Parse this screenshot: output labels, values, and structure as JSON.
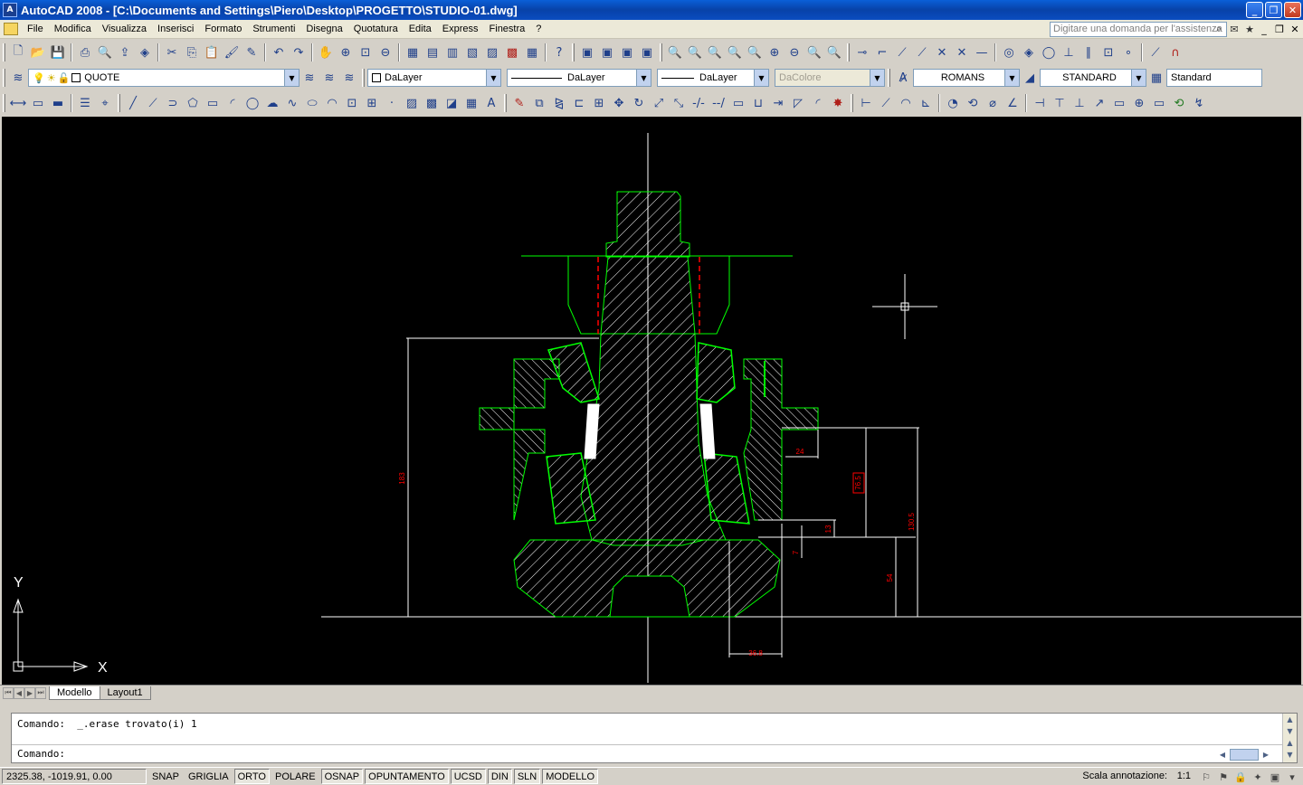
{
  "window": {
    "app_icon_text": "A",
    "title": "AutoCAD 2008 - [C:\\Documents and Settings\\Piero\\Desktop\\PROGETTO\\STUDIO-01.dwg]",
    "buttons": {
      "minimize": "_",
      "maximize": "❐",
      "close": "✕"
    }
  },
  "menu": {
    "items": [
      "File",
      "Modifica",
      "Visualizza",
      "Inserisci",
      "Formato",
      "Strumenti",
      "Disegna",
      "Quotatura",
      "Edita",
      "Express",
      "Finestra",
      "?"
    ],
    "help_placeholder": "Digitare una domanda per l'assistenza",
    "doc_buttons": {
      "minimize": "_",
      "restore": "❐",
      "close": "✕"
    }
  },
  "layers": {
    "current_layer": "QUOTE",
    "color": "DaLayer",
    "linetype": "DaLayer",
    "lineweight": "DaLayer",
    "plot_style": "DaColore"
  },
  "styles": {
    "text_style": "ROMANS",
    "dim_style": "STANDARD",
    "table_style": "Standard"
  },
  "drawing": {
    "background": "#000000",
    "part_color": "#00ff00",
    "dimension_color": "#ffffff",
    "dimension_text_color": "#ff0000",
    "dimensions": {
      "total_height": "183",
      "width_right": "24",
      "mid_height": "76.5",
      "right_height": "130.5",
      "small_gap": "13",
      "tiny_gap": "7",
      "base_height": "54",
      "bottom_width": "36.8"
    },
    "ucs": {
      "x_label": "X",
      "y_label": "Y"
    }
  },
  "tabs": {
    "items": [
      "Modello",
      "Layout1"
    ],
    "active": "Modello"
  },
  "command": {
    "history": "Comando:  _.erase trovato(i) 1",
    "prompt": "Comando:"
  },
  "status": {
    "coordinates": "2325.38, -1019.91, 0.00",
    "toggles": [
      {
        "label": "SNAP",
        "on": false
      },
      {
        "label": "GRIGLIA",
        "on": false
      },
      {
        "label": "ORTO",
        "on": true
      },
      {
        "label": "POLARE",
        "on": false
      },
      {
        "label": "OSNAP",
        "on": true
      },
      {
        "label": "OPUNTAMENTO",
        "on": true
      },
      {
        "label": "UCSD",
        "on": true
      },
      {
        "label": "DIN",
        "on": true
      },
      {
        "label": "SLN",
        "on": true
      },
      {
        "label": "MODELLO",
        "on": true
      }
    ],
    "annotation_scale_label": "Scala annotazione:",
    "annotation_scale_value": "1:1"
  }
}
